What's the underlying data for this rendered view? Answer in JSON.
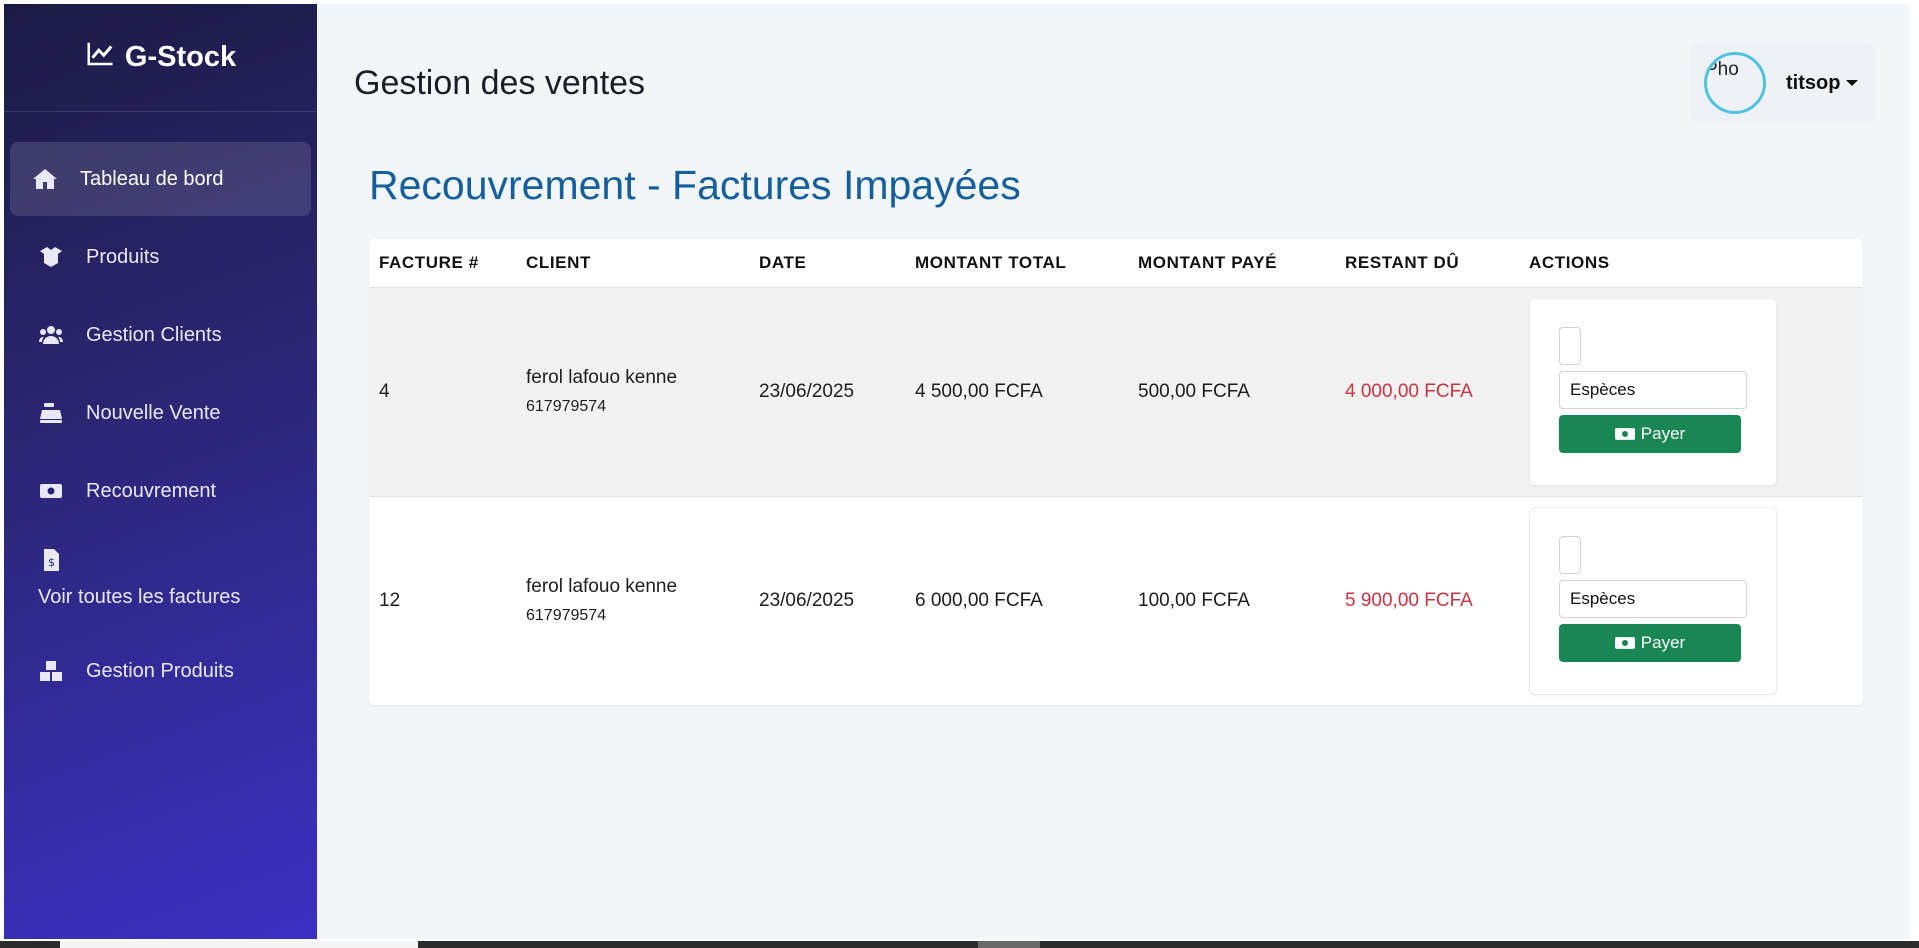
{
  "sidebar": {
    "brand": "G-Stock",
    "items": [
      {
        "label": "Tableau de bord",
        "icon": "home-icon"
      },
      {
        "label": "Produits",
        "icon": "box-open-icon"
      },
      {
        "label": "Gestion Clients",
        "icon": "users-icon"
      },
      {
        "label": "Nouvelle Vente",
        "icon": "cash-register-icon"
      },
      {
        "label": "Recouvrement",
        "icon": "money-bill-icon"
      },
      {
        "label": "Voir toutes les factures",
        "icon": "file-invoice-dollar-icon"
      },
      {
        "label": "Gestion Produits",
        "icon": "boxes-icon"
      }
    ]
  },
  "header": {
    "title": "Gestion des ventes",
    "user": {
      "avatar_alt": "Pho",
      "name": "titsop"
    }
  },
  "main": {
    "section_title": "Recouvrement - Factures Impayées",
    "table": {
      "columns": [
        "FACTURE #",
        "CLIENT",
        "DATE",
        "MONTANT TOTAL",
        "MONTANT PAYÉ",
        "RESTANT DÛ",
        "ACTIONS"
      ],
      "rows": [
        {
          "facture": "4",
          "client_name": "ferol lafouo kenne",
          "client_phone": "617979574",
          "date": "23/06/2025",
          "total": "4 500,00 FCFA",
          "paid": "500,00 FCFA",
          "due": "4 000,00 FCFA",
          "method": "Espèces",
          "pay_label": "Payer"
        },
        {
          "facture": "12",
          "client_name": "ferol lafouo kenne",
          "client_phone": "617979574",
          "date": "23/06/2025",
          "total": "6 000,00 FCFA",
          "paid": "100,00 FCFA",
          "due": "5 900,00 FCFA",
          "method": "Espèces",
          "pay_label": "Payer"
        }
      ]
    }
  },
  "colors": {
    "accent_title": "#155f9c",
    "due_text": "#cc3340",
    "pay_button": "#198754",
    "sidebar_gradient_start": "#1d1b45",
    "sidebar_gradient_end": "#3a31c4"
  }
}
